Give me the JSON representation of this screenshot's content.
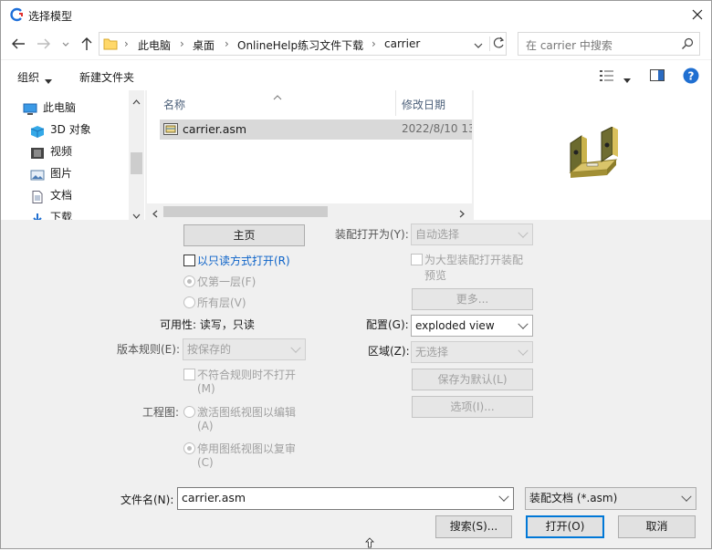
{
  "window": {
    "title": "选择模型"
  },
  "address": {
    "path": [
      "此电脑",
      "桌面",
      "OnlineHelp练习文件下载",
      "carrier"
    ],
    "search_placeholder": "在 carrier 中搜索"
  },
  "toolbar": {
    "organize": "组织",
    "new_folder": "新建文件夹"
  },
  "nav": {
    "items": [
      {
        "label": "此电脑",
        "icon": "computer-icon"
      },
      {
        "label": "3D 对象",
        "icon": "cube-icon"
      },
      {
        "label": "视频",
        "icon": "video-icon"
      },
      {
        "label": "图片",
        "icon": "picture-icon"
      },
      {
        "label": "文档",
        "icon": "document-icon"
      },
      {
        "label": "下载",
        "icon": "download-icon"
      }
    ]
  },
  "filelist": {
    "columns": [
      "名称",
      "修改日期"
    ],
    "rows": [
      {
        "name": "carrier.asm",
        "date": "2022/8/10 13"
      }
    ]
  },
  "options": {
    "home_button": "主页",
    "readonly_label": "以只读方式打开(R)",
    "first_level": "仅第一层(F)",
    "all_levels": "所有层(V)",
    "availability": "可用性: 读写，只读",
    "version_rule_label": "版本规则(E):",
    "version_rule_value": "按保存的",
    "noncompliant_label": "不符合规则时不打开",
    "noncompliant_sub": "(M)",
    "drawing_label": "工程图:",
    "activate_label": "激活图纸视图以编辑",
    "activate_sub": "(A)",
    "disable_label": "停用图纸视图以复审",
    "disable_sub": "(C)",
    "open_as_label": "装配打开为(Y):",
    "open_as_value": "自动选择",
    "large_assembly_label": "为大型装配打开装配",
    "large_assembly_sub": "预览",
    "more_button": "更多...",
    "config_label": "配置(G):",
    "config_value": "exploded view",
    "region_label": "区域(Z):",
    "region_value": "无选择",
    "save_default_button": "保存为默认(L)",
    "options_button": "选项(I)..."
  },
  "footer": {
    "filename_label": "文件名(N):",
    "filename_value": "carrier.asm",
    "filetype_value": "装配文档 (*.asm)",
    "search_button": "搜索(S)...",
    "open_button": "打开(O)",
    "cancel_button": "取消"
  }
}
